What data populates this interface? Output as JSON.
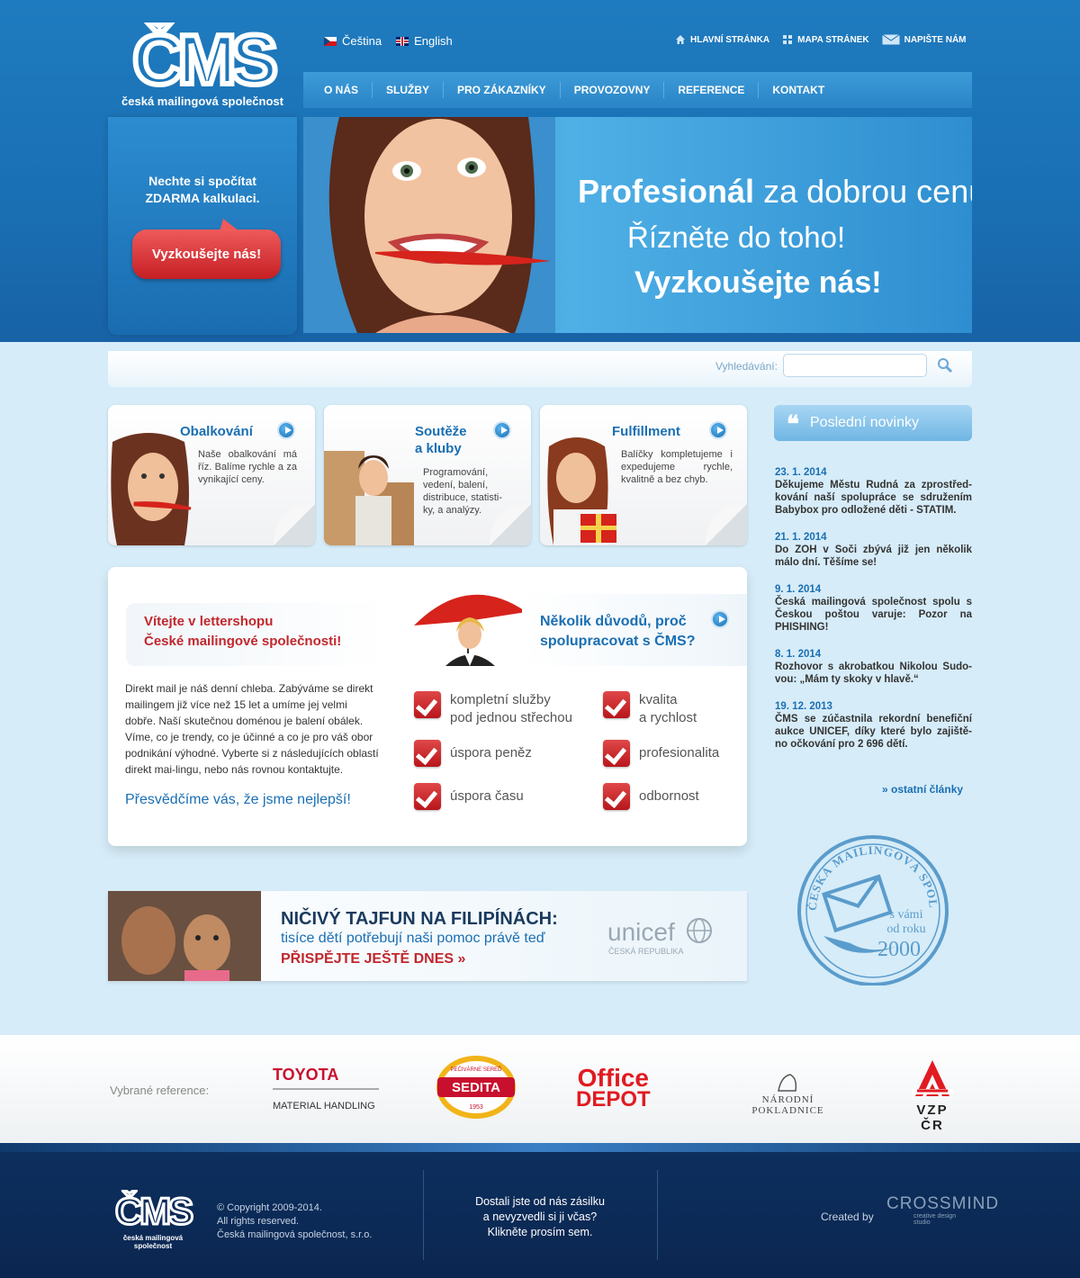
{
  "brand": {
    "logo_text": "česká mailingová společnost"
  },
  "languages": [
    {
      "label": "Čeština",
      "flag": "cz-flag-icon"
    },
    {
      "label": "English",
      "flag": "uk-flag-icon"
    }
  ],
  "top_links": [
    {
      "label": "HLAVNÍ STRÁNKA",
      "icon": "home-icon"
    },
    {
      "label": "MAPA STRÁNEK",
      "icon": "sitemap-icon"
    },
    {
      "label": "NAPIŠTE NÁM",
      "icon": "envelope-icon"
    }
  ],
  "nav": [
    "O NÁS",
    "SLUŽBY",
    "PRO ZÁKAZNÍKY",
    "PROVOZOVNY",
    "REFERENCE",
    "KONTAKT"
  ],
  "calc": {
    "line1": "Nechte si spočítat",
    "line2": "ZDARMA kalkulaci.",
    "button": "Vyzkoušejte nás!"
  },
  "banner": {
    "line1_bold": "Profesionál",
    "line1_rest": " za dobrou cenu.",
    "line2": "Řízněte do toho!",
    "line3": "Vyzkoušejte nás!"
  },
  "search": {
    "label": "Vyhledávání:",
    "placeholder": ""
  },
  "services": [
    {
      "title": "Obalkování",
      "text": "Naše obalkování má říz. Balíme rychle a za vynikající ceny."
    },
    {
      "title_line1": "Soutěže",
      "title_line2": "a kluby",
      "text": "Programování, vedení, balení, distribuce, statisti-ky, a analýzy."
    },
    {
      "title": "Fulfillment",
      "text": "Balíčky kompletujeme i expedujeme rychle, kvalitně a bez chyb."
    }
  ],
  "welcome": {
    "title_line1": "Vítejte v lettershopu",
    "title_line2": "České mailingové společnosti!",
    "text": "Direkt mail je náš denní chleba. Zabýváme se direkt mailingem již více než 15 let a umíme jej velmi dobře. Naší skutečnou doménou je balení obálek. Víme, co je trendy, co je účinné a co je pro váš obor podnikání výhodné. Vyberte si z následujících oblastí direkt mai-lingu, nebo nás rovnou kontaktujte.",
    "cta": "Přesvědčíme vás, že jsme nejlepší!"
  },
  "reasons": {
    "title_line1": "Několik důvodů, proč",
    "title_line2": "spolupracovat s ČMS?",
    "items": [
      {
        "line1": "kompletní služby",
        "line2": "pod jednou střechou"
      },
      {
        "line1": "kvalita",
        "line2": "a rychlost"
      },
      {
        "line1": "úspora peněz",
        "line2": ""
      },
      {
        "line1": "profesionalita",
        "line2": ""
      },
      {
        "line1": "úspora času",
        "line2": ""
      },
      {
        "line1": "odbornost",
        "line2": ""
      }
    ]
  },
  "news": {
    "heading": "Poslední novinky",
    "items": [
      {
        "date": "23. 1. 2014",
        "text": "Děkujeme Městu Rudná za zprostřed-kování naší spolupráce se sdružením Babybox pro odložené děti - STATIM."
      },
      {
        "date": "21. 1. 2014",
        "text": "Do ZOH v Soči zbývá již jen několik málo dní. Těšíme se!"
      },
      {
        "date": "9. 1. 2014",
        "text": "Česká mailingová společnost spolu s Českou poštou varuje: Pozor na PHISHING!"
      },
      {
        "date": "8. 1. 2014",
        "text": "Rozhovor s akrobatkou Nikolou Sudo-vou: „Mám ty skoky v hlavě.“"
      },
      {
        "date": "19. 12. 2013",
        "text": "ČMS se zúčastnila rekordní benefiční aukce UNICEF, díky které bylo zajiště-no očkování pro 2 696 dětí."
      }
    ],
    "more": "» ostatní články"
  },
  "stamp": {
    "ring_text": "ČESKÁ MAILINGOVÁ SPOLEČNOST",
    "line1": "s vámi",
    "line2": "od roku",
    "year": "2000"
  },
  "unicef": {
    "headline": "NIČIVÝ TAJFUN NA FILIPÍNÁCH:",
    "sub": "tisíce dětí potřebují naši pomoc právě teď",
    "cta": "PŘISPĚJTE JEŠTĚ DNES »",
    "logo": "unicef",
    "logo_sub": "ČESKÁ REPUBLIKA"
  },
  "references": {
    "label": "Vybrané reference:",
    "toyota_line1": "TOYOTA",
    "toyota_line2": "MATERIAL HANDLING",
    "sedita": "SEDITA",
    "sedita_top": "PEČIVÁRNE SEREĎ",
    "sedita_year": "1953",
    "office_line1": "Office",
    "office_line2": "DEPOT",
    "narodni": "NÁRODNÍ POKLADNICE",
    "vzp": "VZP ČR"
  },
  "footer": {
    "copy_line1": "© Copyright 2009-2014.",
    "copy_line2": "All rights reserved.",
    "copy_line3": "Česká mailingová společnost, s.r.o.",
    "mid_line1": "Dostali jste od nás zásilku",
    "mid_line2": "a nevyzvedli si ji včas?",
    "mid_line3": "Klikněte prosím sem.",
    "created_by": "Created by",
    "crossmind": "CROSSMIND",
    "crossmind_sub": "creative design studio",
    "logo_text": "česká mailingová společnost"
  },
  "colors": {
    "primary_blue": "#1a6fb3",
    "accent_red": "#c1272d",
    "footer_navy": "#0b2650"
  }
}
